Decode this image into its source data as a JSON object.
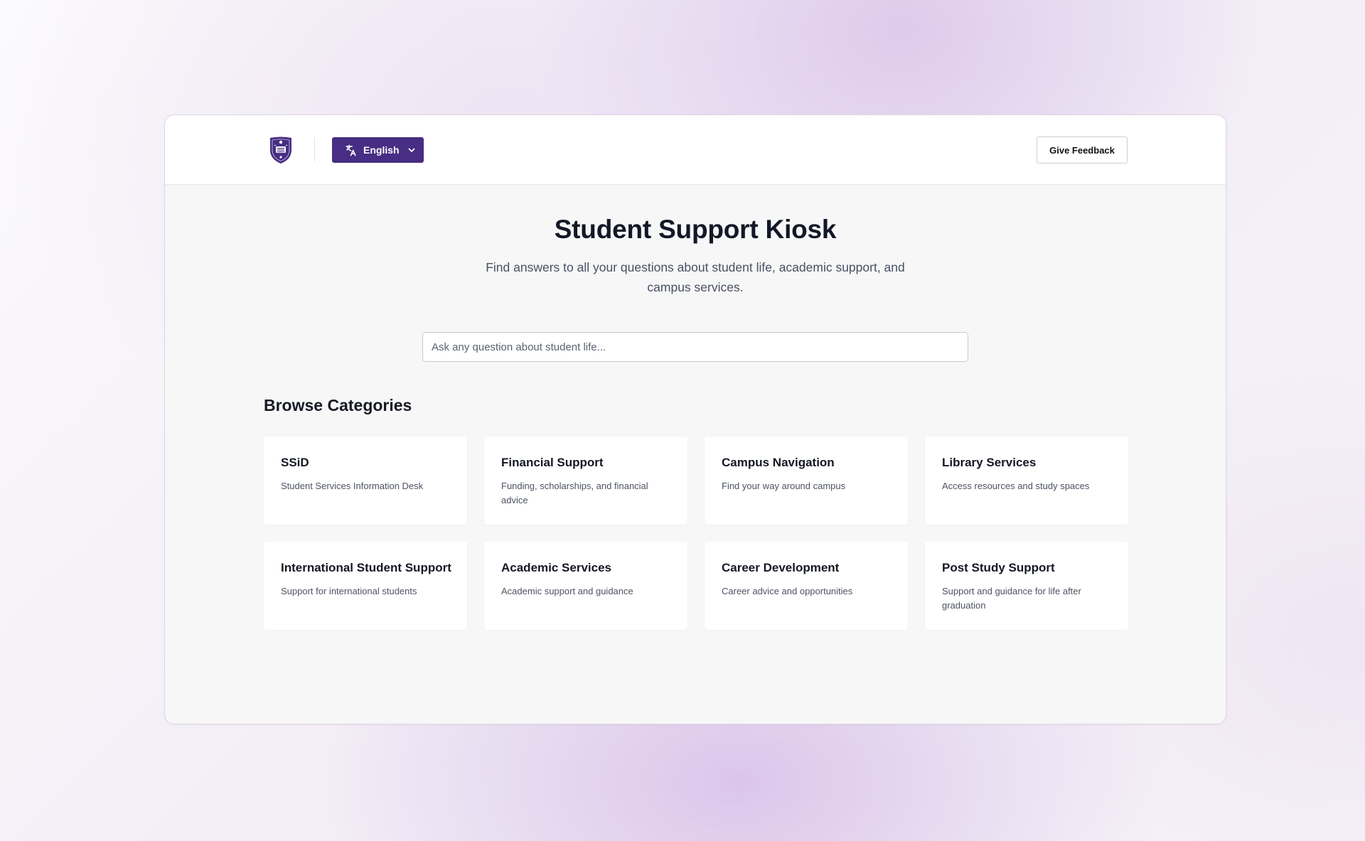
{
  "header": {
    "logo_icon": "university-crest-icon",
    "language": {
      "label": "English",
      "icon": "translate-icon",
      "chevron": "chevron-down-icon"
    },
    "feedback_label": "Give Feedback"
  },
  "hero": {
    "title": "Student Support Kiosk",
    "subtitle": "Find answers to all your questions about student life, academic support, and campus services."
  },
  "search": {
    "placeholder": "Ask any question about student life...",
    "value": ""
  },
  "browse": {
    "title": "Browse Categories",
    "categories": [
      {
        "title": "SSiD",
        "description": "Student Services Information Desk"
      },
      {
        "title": "Financial Support",
        "description": "Funding, scholarships, and financial advice"
      },
      {
        "title": "Campus Navigation",
        "description": "Find your way around campus"
      },
      {
        "title": "Library Services",
        "description": "Access resources and study spaces"
      },
      {
        "title": "International Student Support",
        "description": "Support for international students"
      },
      {
        "title": "Academic Services",
        "description": "Academic support and guidance"
      },
      {
        "title": "Career Development",
        "description": "Career advice and opportunities"
      },
      {
        "title": "Post Study Support",
        "description": "Support and guidance for life after graduation"
      }
    ]
  },
  "colors": {
    "accent": "#472d83",
    "heading": "#121826",
    "body_text": "#495061",
    "panel_bg": "#f7f7f8"
  }
}
